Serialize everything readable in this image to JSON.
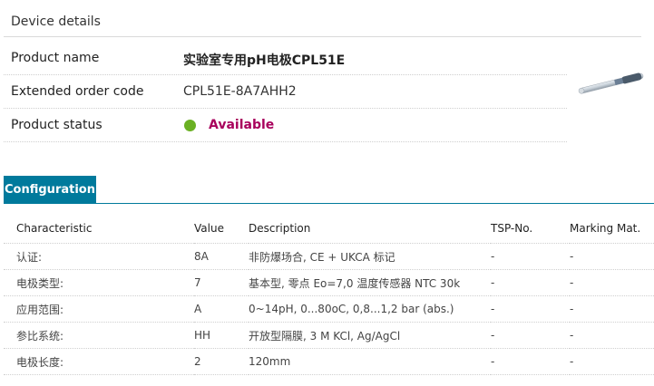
{
  "device_details": {
    "title": "Device details",
    "rows": [
      {
        "label": "Product name",
        "value": "实验室专用pH电极CPL51E"
      },
      {
        "label": "Extended order code",
        "value": "CPL51E-8A7AHH2"
      },
      {
        "label": "Product status",
        "value": "Available"
      }
    ],
    "status_color": "#6ab023",
    "status_text_color": "#a8005c",
    "product_image": "ph-electrode-image"
  },
  "configuration": {
    "tab_label": "Configuration",
    "accent_color": "#007a9c",
    "columns": [
      "Characteristic",
      "Value",
      "Description",
      "TSP-No.",
      "Marking Mat."
    ],
    "rows": [
      [
        "认证:",
        "8A",
        "非防爆场合, CE + UKCA 标记",
        "-",
        "-"
      ],
      [
        "电极类型:",
        "7",
        "基本型, 零点 Eo=7,0 温度传感器 NTC 30k",
        "-",
        "-"
      ],
      [
        "应用范围:",
        "A",
        "0~14pH, 0...80oC, 0,8...1,2 bar (abs.)",
        "-",
        "-"
      ],
      [
        "参比系统:",
        "HH",
        "开放型隔膜, 3 M KCl, Ag/AgCl",
        "-",
        "-"
      ],
      [
        "电极长度:",
        "2",
        "120mm",
        "-",
        "-"
      ]
    ]
  }
}
